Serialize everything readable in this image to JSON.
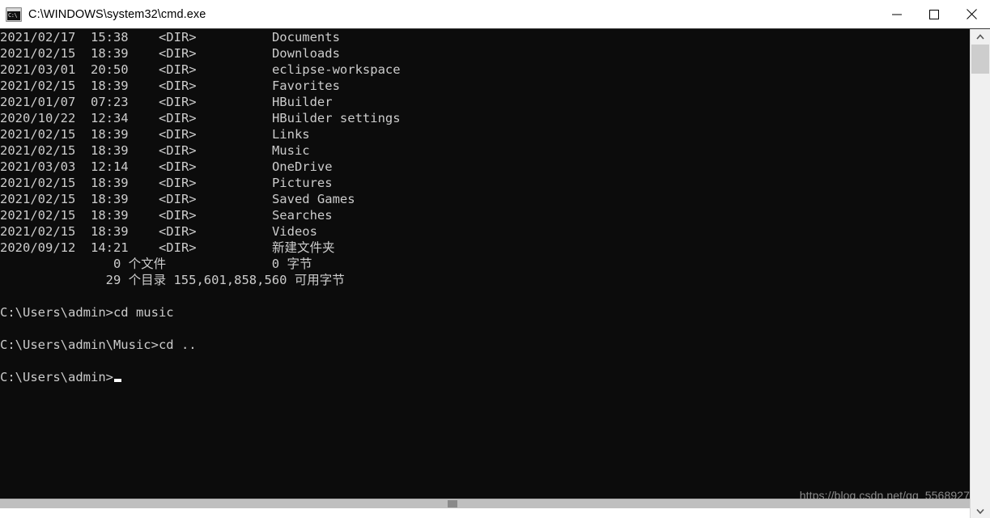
{
  "window": {
    "title": "C:\\WINDOWS\\system32\\cmd.exe",
    "icon": "cmd-prompt-icon",
    "icon_glyph": "C:\\",
    "minimize_label": "—",
    "maximize_label": "□",
    "close_label": "✕",
    "background_color": "#0c0c0c",
    "text_color": "#cccccc"
  },
  "terminal": {
    "lines": [
      "2021/02/17  15:38    <DIR>          Documents",
      "2021/02/15  18:39    <DIR>          Downloads",
      "2021/03/01  20:50    <DIR>          eclipse-workspace",
      "2021/02/15  18:39    <DIR>          Favorites",
      "2021/01/07  07:23    <DIR>          HBuilder",
      "2020/10/22  12:34    <DIR>          HBuilder settings",
      "2021/02/15  18:39    <DIR>          Links",
      "2021/02/15  18:39    <DIR>          Music",
      "2021/03/03  12:14    <DIR>          OneDrive",
      "2021/02/15  18:39    <DIR>          Pictures",
      "2021/02/15  18:39    <DIR>          Saved Games",
      "2021/02/15  18:39    <DIR>          Searches",
      "2021/02/15  18:39    <DIR>          Videos",
      "2020/09/12  14:21    <DIR>          新建文件夹",
      "               0 个文件              0 字节",
      "              29 个目录 155,601,858,560 可用字节",
      "",
      "C:\\Users\\admin>cd music",
      "",
      "C:\\Users\\admin\\Music>cd ..",
      "",
      "C:\\Users\\admin>"
    ],
    "cursor_visible": true
  },
  "watermark": {
    "text": "https://blog.csdn.net/qq_5568927"
  },
  "scrollbars": {
    "vertical_up_arrow": "⌃",
    "vertical_down_arrow": "⌄",
    "vertical_thumb": "scroll-thumb",
    "horizontal_thumb": "scroll-thumb"
  }
}
